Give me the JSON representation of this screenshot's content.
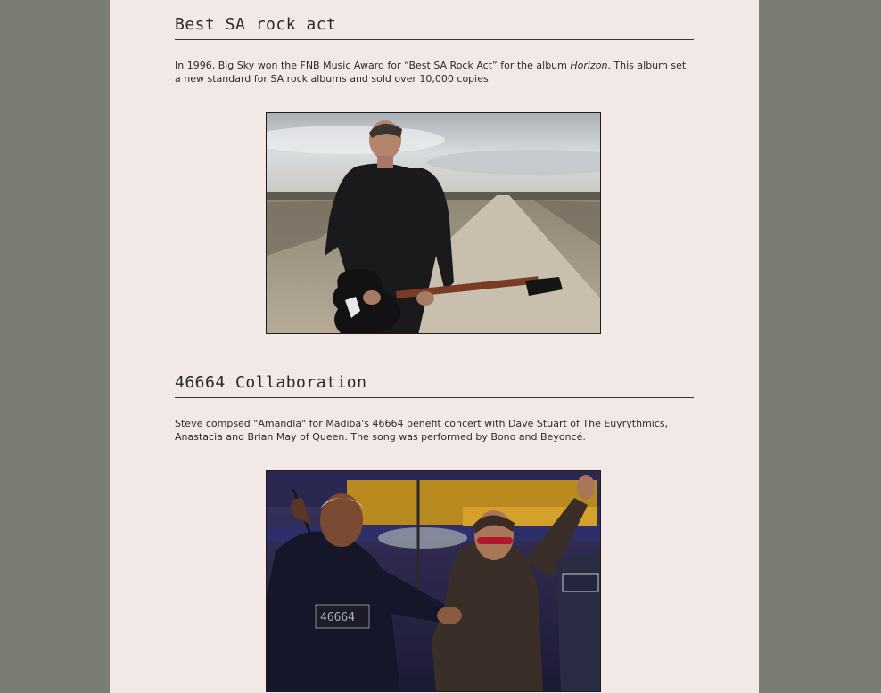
{
  "section1": {
    "heading": "Best SA rock act",
    "text_before": "In 1996, Big Sky won the FNB Music Award for “Best SA Rock Act” for the album ",
    "album": "Horizon",
    "text_after": ". This album set a new standard for SA rock albums and sold over 10,000 copies"
  },
  "section2": {
    "heading": "46664 Collaboration",
    "text": "Steve compsed \"Amandla\" for Madiba's 46664 benefit concert with Dave Stuart of The Euyrythmics, Anastacia and Brian May of Queen. The song was performed by Bono and Beyoncé."
  },
  "colors": {
    "background": "#7b7c74",
    "page": "#f2e9e6",
    "heading": "#2b2727"
  }
}
